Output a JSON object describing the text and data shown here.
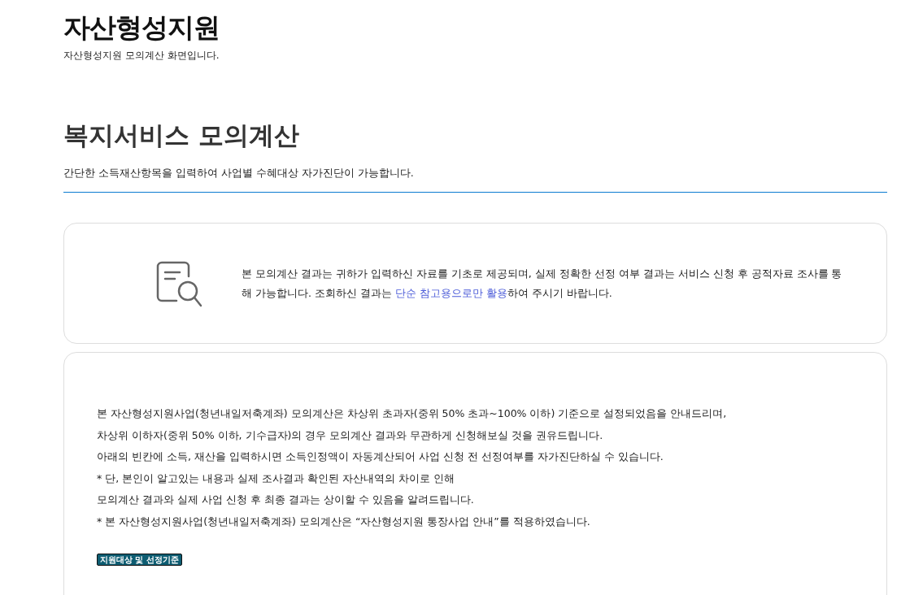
{
  "header": {
    "title": "자산형성지원",
    "subtitle": "자산형성지원 모의계산 화면입니다."
  },
  "section": {
    "title": "복지서비스 모의계산",
    "description": "간단한 소득재산항목을 입력하여 사업별 수혜대상 자가진단이 가능합니다."
  },
  "notice": {
    "text_before": "본 모의계산 결과는 귀하가 입력하신 자료를 기초로 제공되며, 실제 정확한 선정 여부 결과는 서비스 신청 후 공적자료 조사를 통해 가능합니다. 조회하신 결과는 ",
    "highlight": "단순 참고용으로만 활용",
    "text_after": "하여 주시기 바랍니다."
  },
  "info": {
    "lines": [
      "본 자산형성지원사업(청년내일저축계좌) 모의계산은 차상위 초과자(중위 50% 초과~100% 이하) 기준으로 설정되었음을 안내드리며,",
      "차상위 이하자(중위 50% 이하, 기수급자)의 경우 모의계산 결과와 무관하게 신청해보실 것을 권유드립니다.",
      "아래의 빈칸에 소득, 재산을 입력하시면 소득인정액이 자동계산되어 사업 신청 전 선정여부를 자가진단하실 수 있습니다.",
      "* 단, 본인이 알고있는 내용과 실제 조사결과 확인된 자산내역의 차이로 인해",
      "모의계산 결과와 실제 사업 신청 후 최종 결과는 상이할 수 있음을 알려드립니다.",
      "* 본 자산형성지원사업(청년내일저축계좌) 모의계산은 “자산형성지원 통장사업 안내”를 적용하였습니다."
    ],
    "badge": "지원대상 및 선정기준"
  }
}
